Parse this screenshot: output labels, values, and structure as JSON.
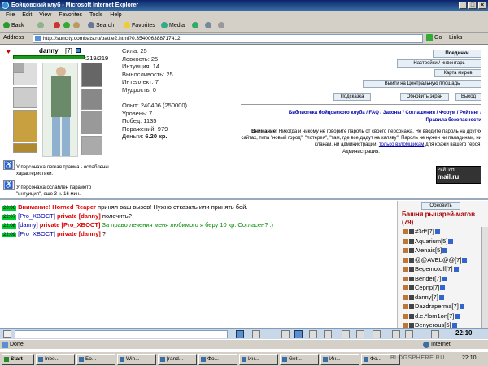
{
  "window": {
    "title": "Бойцовский клуб - Microsoft Internet Explorer",
    "min": "_",
    "max": "□",
    "close": "×"
  },
  "menu": [
    "File",
    "Edit",
    "View",
    "Favorites",
    "Tools",
    "Help"
  ],
  "toolbar": {
    "back": "Back",
    "search": "Search",
    "favorites": "Favorites",
    "media": "Media"
  },
  "address": {
    "label": "Address",
    "url": "http://suncity.combats.ru/battle2.html?0.354006388717412",
    "go": "Go",
    "links": "Links"
  },
  "char": {
    "name": "danny",
    "level": "[7]",
    "hp": ":219/219"
  },
  "stats": {
    "Сила": "Сила: 25",
    "Ловкость": "Ловкость: 25",
    "Интуиция": "Интуиция: 14",
    "Выносливость": "Выносливость: 25",
    "Интеллект": "Интеллект: 7",
    "Мудрость": "Мудрость: 0"
  },
  "stats2": [
    "Опыт: 240406 (250000)",
    "Уровень: 7",
    "Побед: 1135",
    "Поражений: 979"
  ],
  "money_label": "Деньги:",
  "money_value": "6.20 кр.",
  "buttons": {
    "fights": "Поединки",
    "settings": "Настройки / инвентарь",
    "map": "Карта миров",
    "exit_square": "Выйти на Центральную площадь",
    "hint": "Подсказка",
    "refresh_screen": "Обновить экран",
    "exit": "Выход",
    "refresh": "Обновить"
  },
  "links": {
    "line1": "Библиотека бойцовского клуба / FAQ / Законы / Соглашения / Форум / Рейтинг /",
    "line2": "Правила безопасности"
  },
  "warning": {
    "bold": "Внимание!",
    "text": " Никогда и никому не говорите пароль от своего персонажа. Не вводите пароль на других сайтах, типа \"новый город\", \"лотерея\", \"там, где все дадут на халяву\". Пароль не нужен ни паладинам, ни кланам, ни администрации, ",
    "link": "только взломщикам",
    "text2": " для кражи вашего героя.",
    "sign": "Администрация."
  },
  "counter": {
    "l1": "РЕЙТИНГ",
    "l2": "mail.ru"
  },
  "traumas": [
    "У персонажа легкая травма - ослаблены характеристики.",
    "У персонажа ослаблен параметр \"интуиция\", еще 3 ч. 16 мин."
  ],
  "chat": [
    {
      "time": "20:06",
      "parts": [
        {
          "c": "red",
          "t": "Внимание! "
        },
        {
          "c": "red",
          "t": "Horned Reaper"
        },
        {
          "c": "",
          "t": " принял ваш вызов! Нужно отказать или принять бой."
        }
      ]
    },
    {
      "time": "22:07",
      "parts": [
        {
          "c": "blue",
          "t": "[Pro_XBOCT] "
        },
        {
          "c": "red",
          "t": "private [danny]"
        },
        {
          "c": "",
          "t": " полечить?"
        }
      ]
    },
    {
      "time": "22:08",
      "parts": [
        {
          "c": "blue",
          "t": "[danny] "
        },
        {
          "c": "red",
          "t": "private [Pro_XBOCT]"
        },
        {
          "c": "green",
          "t": " За право лечения меня любимого я беру 10 кр. Согласен? :)"
        }
      ]
    },
    {
      "time": "22:09",
      "parts": [
        {
          "c": "blue",
          "t": "[Pro_XBOCT] "
        },
        {
          "c": "red",
          "t": "private [danny]"
        },
        {
          "c": "",
          "t": " ?"
        }
      ]
    }
  ],
  "room": {
    "title": "Башня рыцарей-магов (79)"
  },
  "players": [
    "#3d*[7]",
    "Aquarium[5]",
    "Atenais[5]",
    "@@AVEL@@[7]",
    "Begemotoff[7]",
    "Bender[7]",
    "Cepnp[7]",
    "danny[7]",
    "Dazdraperma[7]",
    "d.e.*lom1on[7]",
    "Denyerous[5]"
  ],
  "status": {
    "done": "Done",
    "zone": "Internet",
    "clock": "22:10"
  },
  "taskbar": {
    "start": "Start",
    "tasks": [
      "Inbo...",
      "Бо...",
      "Win...",
      "[rand...",
      "Фо...",
      "Ин...",
      "Get...",
      "Ин...",
      "Фо..."
    ],
    "time": "22:10"
  },
  "watermark": "BLOGSPHERE.RU",
  "colors": {
    "accent": "#0a246a",
    "hp": "#1a9a1a",
    "link": "#00a",
    "alert": "#d00"
  }
}
